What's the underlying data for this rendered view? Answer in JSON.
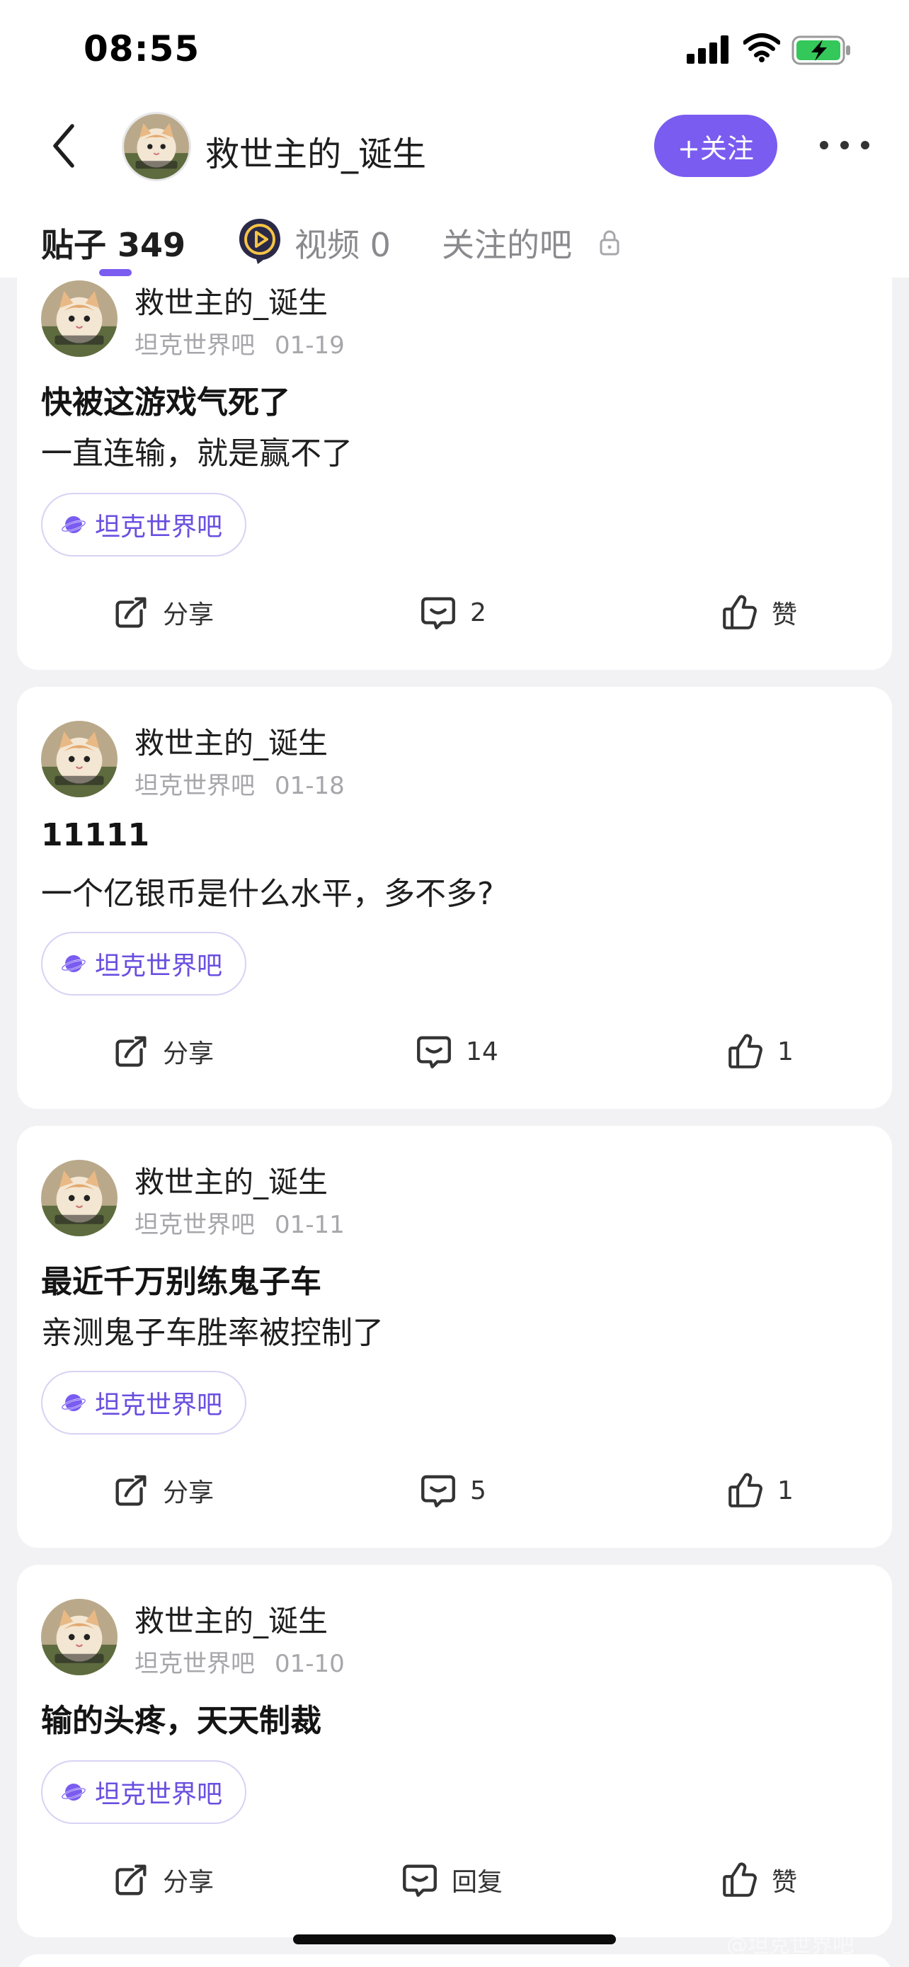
{
  "status": {
    "time": "08:55"
  },
  "nav": {
    "title": "救世主的_诞生",
    "follow_label": "+关注"
  },
  "tabs": [
    {
      "label": "贴子 349"
    },
    {
      "label": "视频 0"
    },
    {
      "label": "关注的吧"
    }
  ],
  "colors": {
    "accent": "#7a5cf0",
    "tag_text": "#6a4fe0",
    "meta": "#a6a6ab"
  },
  "posts": [
    {
      "author": "救世主的_诞生",
      "forum": "坦克世界吧",
      "date": "01-19",
      "title": "快被这游戏气死了",
      "body": "一直连输，就是赢不了",
      "tag": "坦克世界吧",
      "share": "分享",
      "comments": "2",
      "likes": "赞"
    },
    {
      "author": "救世主的_诞生",
      "forum": "坦克世界吧",
      "date": "01-18",
      "title": "11111",
      "body": "一个亿银币是什么水平，多不多?",
      "tag": "坦克世界吧",
      "share": "分享",
      "comments": "14",
      "likes": "1"
    },
    {
      "author": "救世主的_诞生",
      "forum": "坦克世界吧",
      "date": "01-11",
      "title": "最近千万别练鬼子车",
      "body": "亲测鬼子车胜率被控制了",
      "tag": "坦克世界吧",
      "share": "分享",
      "comments": "5",
      "likes": "1"
    },
    {
      "author": "救世主的_诞生",
      "forum": "坦克世界吧",
      "date": "01-10",
      "title": "输的头疼，天天制裁",
      "body": "",
      "tag": "坦克世界吧",
      "share": "分享",
      "comments": "回复",
      "likes": "赞"
    }
  ],
  "watermark": "@坦克世界吧"
}
